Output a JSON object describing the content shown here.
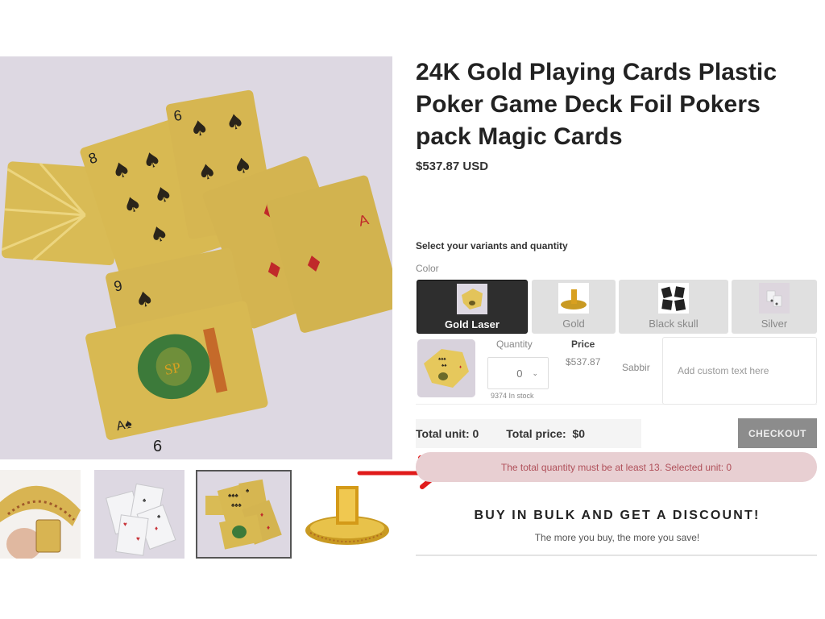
{
  "product": {
    "title": "24K Gold Playing Cards Plastic Poker Game Deck Foil Pokers pack Magic Cards",
    "price": "$537.87 USD"
  },
  "gallery": {
    "main_image": "gold-playing-cards-spread",
    "thumbnails": [
      {
        "name": "gold-cards-fanned-in-hand",
        "selected": false
      },
      {
        "name": "silver-cards-spread",
        "selected": false
      },
      {
        "name": "gold-cards-spread",
        "selected": true
      },
      {
        "name": "gold-cards-deck-stand",
        "selected": false
      }
    ]
  },
  "variants": {
    "heading": "Select your variants and quantity",
    "color_label": "Color",
    "options": [
      {
        "label": "Gold Laser",
        "selected": true
      },
      {
        "label": "Gold",
        "selected": false
      },
      {
        "label": "Black skull",
        "selected": false
      },
      {
        "label": "Silver",
        "selected": false
      }
    ]
  },
  "variant_row": {
    "quantity_header": "Quantity",
    "quantity_value": "0",
    "stock": "9374 In stock",
    "price_header": "Price",
    "price_value": "$537.87",
    "seller": "Sabbir",
    "custom_text_placeholder": "Add custom text here"
  },
  "totals": {
    "total_unit": "Total unit: 0",
    "total_price": "Total price:  $0",
    "checkout_label": "CHECKOUT"
  },
  "error": {
    "message": "The total quantity must be at least 13. Selected unit: 0"
  },
  "bulk": {
    "title": "BUY IN BULK AND GET A DISCOUNT!",
    "subtitle": "The more you buy, the more you save!"
  },
  "colors": {
    "error_bg": "#e8cfd2",
    "error_text": "#b0505a",
    "annotation_arrow": "#e01b1b",
    "selected_swatch": "#2e2e2e",
    "checkout_bg": "#8c8c8c"
  }
}
